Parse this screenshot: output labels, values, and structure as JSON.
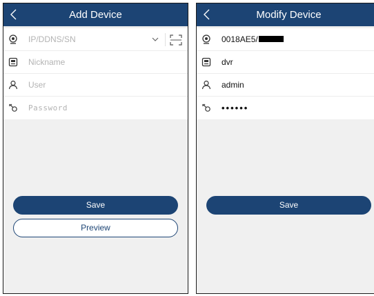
{
  "left": {
    "header": {
      "title": "Add Device"
    },
    "form": {
      "address": {
        "placeholder": "IP/DDNS/SN"
      },
      "nickname": {
        "placeholder": "Nickname"
      },
      "user": {
        "placeholder": "User"
      },
      "password": {
        "placeholder": "Password"
      }
    },
    "buttons": {
      "save": "Save",
      "preview": "Preview"
    }
  },
  "right": {
    "header": {
      "title": "Modify Device"
    },
    "form": {
      "address": {
        "value": "0018AE5/"
      },
      "nickname": {
        "value": "dvr"
      },
      "user": {
        "value": "admin"
      },
      "password": {
        "value": "••••••"
      }
    },
    "buttons": {
      "save": "Save"
    }
  },
  "colors": {
    "header": "#1c4474",
    "background": "#f0f0f0",
    "field_bg": "#ffffff",
    "placeholder": "#b3b3b3"
  },
  "icons": [
    "back-arrow-icon",
    "device-eye-icon",
    "device-card-icon",
    "user-icon",
    "key-icon",
    "chevron-down-icon",
    "scan-icon"
  ]
}
